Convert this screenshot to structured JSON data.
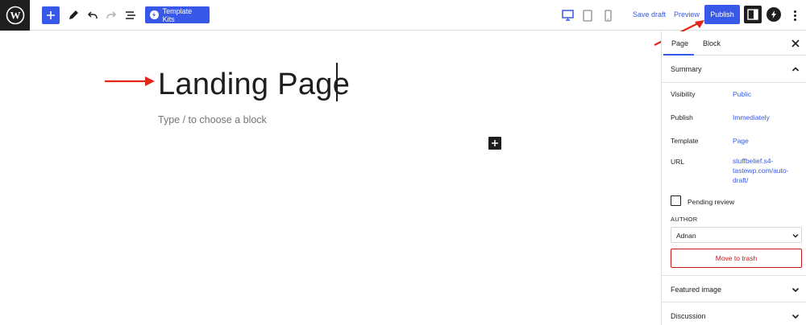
{
  "toolbar": {
    "logo_icon": "wordpress-logo-icon",
    "add_block_icon": "plus-icon",
    "tools_icon": "pencil-icon",
    "undo_icon": "undo-icon",
    "redo_icon": "redo-icon",
    "list_view_icon": "list-view-icon",
    "template_kits_label": "Template Kits",
    "devices": [
      "desktop-icon",
      "tablet-icon",
      "mobile-icon"
    ],
    "save_draft_label": "Save draft",
    "preview_label": "Preview",
    "publish_label": "Publish",
    "accent_color": "#3858e9"
  },
  "editor": {
    "title": "Landing Page",
    "block_placeholder": "Type / to choose a block",
    "annotation_color": "#e0271a"
  },
  "sidebar": {
    "tabs": [
      {
        "label": "Page",
        "active": true
      },
      {
        "label": "Block",
        "active": false
      }
    ],
    "summary": {
      "title": "Summary",
      "rows": [
        {
          "label": "Visibility",
          "value": "Public"
        },
        {
          "label": "Publish",
          "value": "Immediately"
        },
        {
          "label": "Template",
          "value": "Page"
        },
        {
          "label": "URL",
          "value": "stuffbelief.s4-tastewp.com/auto-draft/"
        }
      ],
      "pending_review_label": "Pending review",
      "author_label": "AUTHOR",
      "author_value": "Adnan",
      "trash_label": "Move to trash"
    },
    "panels": [
      {
        "title": "Featured image"
      },
      {
        "title": "Discussion"
      }
    ]
  }
}
